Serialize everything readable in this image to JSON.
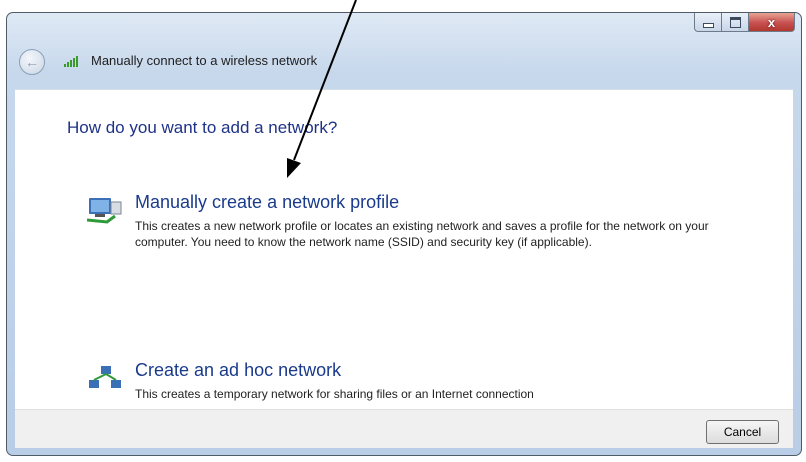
{
  "window": {
    "title": "Manually connect to a wireless network",
    "close_glyph": "x"
  },
  "content": {
    "heading": "How do you want to add a network?",
    "options": [
      {
        "title": "Manually create a network profile",
        "description": "This creates a new network profile or locates an existing network and saves a profile for the network on your computer. You need to know the network name (SSID) and security key (if applicable).",
        "icon": "network-profile-icon"
      },
      {
        "title": "Create an ad hoc network",
        "description": "This creates a temporary network for sharing files or an Internet connection",
        "icon": "ad-hoc-network-icon"
      }
    ]
  },
  "footer": {
    "cancel_label": "Cancel"
  },
  "colors": {
    "heading": "#1e3287",
    "option_title": "#1a3b8c",
    "close_button": "#c75050"
  }
}
